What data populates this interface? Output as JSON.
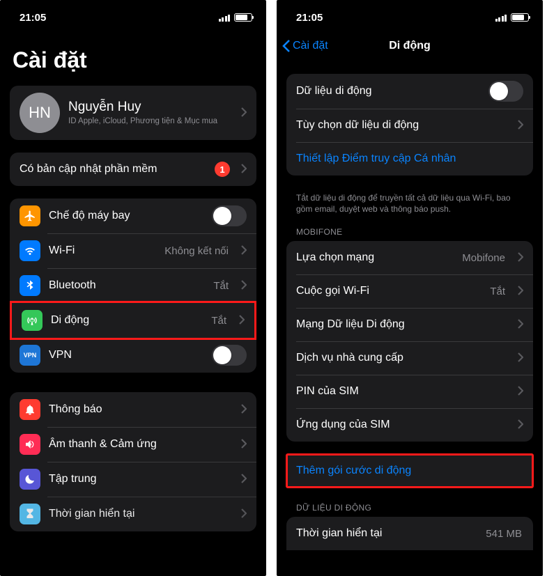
{
  "status": {
    "time": "21:05"
  },
  "left": {
    "title": "Cài đặt",
    "profile": {
      "initials": "HN",
      "name": "Nguyễn Huy",
      "subtitle": "ID Apple, iCloud, Phương tiện & Mục mua"
    },
    "update": {
      "label": "Có bản cập nhật phần mềm",
      "badge": "1"
    },
    "g1": {
      "airplane": "Chế độ máy bay",
      "wifi": "Wi-Fi",
      "wifi_val": "Không kết nối",
      "bt": "Bluetooth",
      "bt_val": "Tắt",
      "cell": "Di động",
      "cell_val": "Tắt",
      "vpn": "VPN"
    },
    "g2": {
      "notif": "Thông báo",
      "sound": "Âm thanh & Cảm ứng",
      "focus": "Tập trung",
      "screentime": "Thời gian hiển tại"
    }
  },
  "right": {
    "back": "Cài đặt",
    "title": "Di động",
    "g1": {
      "data": "Dữ liệu di động",
      "opts": "Tùy chọn dữ liệu di động",
      "hotspot": "Thiết lập Điểm truy cập Cá nhân"
    },
    "note1": "Tắt dữ liệu di động để truyền tất cả dữ liệu qua Wi-Fi, bao gồm email, duyệt web và thông báo push.",
    "hdr_carrier": "MOBIFONE",
    "g2": {
      "net": "Lựa chọn mạng",
      "net_val": "Mobifone",
      "wificall": "Cuộc gọi Wi-Fi",
      "wificall_val": "Tắt",
      "datanet": "Mạng Dữ liệu Di động",
      "carrier": "Dịch vụ nhà cung cấp",
      "simpin": "PIN của SIM",
      "simapp": "Ứng dụng của SIM"
    },
    "g3": {
      "addplan": "Thêm gói cước di động"
    },
    "hdr_data": "DỮ LIỆU DI ĐỘNG",
    "g4": {
      "period": "Thời gian hiển tại",
      "period_val": "541 MB"
    }
  }
}
